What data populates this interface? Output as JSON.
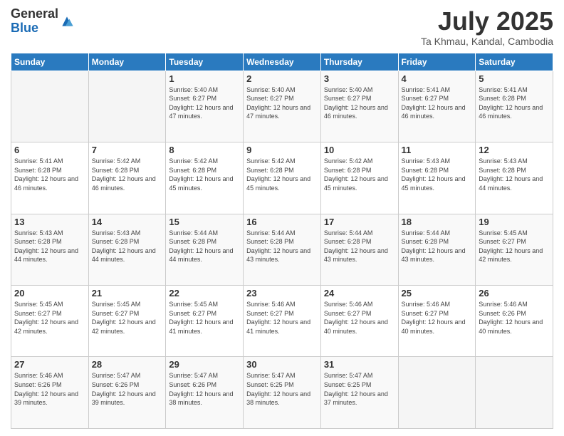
{
  "logo": {
    "general": "General",
    "blue": "Blue"
  },
  "header": {
    "month": "July 2025",
    "location": "Ta Khmau, Kandal, Cambodia"
  },
  "weekdays": [
    "Sunday",
    "Monday",
    "Tuesday",
    "Wednesday",
    "Thursday",
    "Friday",
    "Saturday"
  ],
  "weeks": [
    [
      {
        "day": "",
        "info": ""
      },
      {
        "day": "",
        "info": ""
      },
      {
        "day": "1",
        "info": "Sunrise: 5:40 AM\nSunset: 6:27 PM\nDaylight: 12 hours and 47 minutes."
      },
      {
        "day": "2",
        "info": "Sunrise: 5:40 AM\nSunset: 6:27 PM\nDaylight: 12 hours and 47 minutes."
      },
      {
        "day": "3",
        "info": "Sunrise: 5:40 AM\nSunset: 6:27 PM\nDaylight: 12 hours and 46 minutes."
      },
      {
        "day": "4",
        "info": "Sunrise: 5:41 AM\nSunset: 6:27 PM\nDaylight: 12 hours and 46 minutes."
      },
      {
        "day": "5",
        "info": "Sunrise: 5:41 AM\nSunset: 6:28 PM\nDaylight: 12 hours and 46 minutes."
      }
    ],
    [
      {
        "day": "6",
        "info": "Sunrise: 5:41 AM\nSunset: 6:28 PM\nDaylight: 12 hours and 46 minutes."
      },
      {
        "day": "7",
        "info": "Sunrise: 5:42 AM\nSunset: 6:28 PM\nDaylight: 12 hours and 46 minutes."
      },
      {
        "day": "8",
        "info": "Sunrise: 5:42 AM\nSunset: 6:28 PM\nDaylight: 12 hours and 45 minutes."
      },
      {
        "day": "9",
        "info": "Sunrise: 5:42 AM\nSunset: 6:28 PM\nDaylight: 12 hours and 45 minutes."
      },
      {
        "day": "10",
        "info": "Sunrise: 5:42 AM\nSunset: 6:28 PM\nDaylight: 12 hours and 45 minutes."
      },
      {
        "day": "11",
        "info": "Sunrise: 5:43 AM\nSunset: 6:28 PM\nDaylight: 12 hours and 45 minutes."
      },
      {
        "day": "12",
        "info": "Sunrise: 5:43 AM\nSunset: 6:28 PM\nDaylight: 12 hours and 44 minutes."
      }
    ],
    [
      {
        "day": "13",
        "info": "Sunrise: 5:43 AM\nSunset: 6:28 PM\nDaylight: 12 hours and 44 minutes."
      },
      {
        "day": "14",
        "info": "Sunrise: 5:43 AM\nSunset: 6:28 PM\nDaylight: 12 hours and 44 minutes."
      },
      {
        "day": "15",
        "info": "Sunrise: 5:44 AM\nSunset: 6:28 PM\nDaylight: 12 hours and 44 minutes."
      },
      {
        "day": "16",
        "info": "Sunrise: 5:44 AM\nSunset: 6:28 PM\nDaylight: 12 hours and 43 minutes."
      },
      {
        "day": "17",
        "info": "Sunrise: 5:44 AM\nSunset: 6:28 PM\nDaylight: 12 hours and 43 minutes."
      },
      {
        "day": "18",
        "info": "Sunrise: 5:44 AM\nSunset: 6:28 PM\nDaylight: 12 hours and 43 minutes."
      },
      {
        "day": "19",
        "info": "Sunrise: 5:45 AM\nSunset: 6:27 PM\nDaylight: 12 hours and 42 minutes."
      }
    ],
    [
      {
        "day": "20",
        "info": "Sunrise: 5:45 AM\nSunset: 6:27 PM\nDaylight: 12 hours and 42 minutes."
      },
      {
        "day": "21",
        "info": "Sunrise: 5:45 AM\nSunset: 6:27 PM\nDaylight: 12 hours and 42 minutes."
      },
      {
        "day": "22",
        "info": "Sunrise: 5:45 AM\nSunset: 6:27 PM\nDaylight: 12 hours and 41 minutes."
      },
      {
        "day": "23",
        "info": "Sunrise: 5:46 AM\nSunset: 6:27 PM\nDaylight: 12 hours and 41 minutes."
      },
      {
        "day": "24",
        "info": "Sunrise: 5:46 AM\nSunset: 6:27 PM\nDaylight: 12 hours and 40 minutes."
      },
      {
        "day": "25",
        "info": "Sunrise: 5:46 AM\nSunset: 6:27 PM\nDaylight: 12 hours and 40 minutes."
      },
      {
        "day": "26",
        "info": "Sunrise: 5:46 AM\nSunset: 6:26 PM\nDaylight: 12 hours and 40 minutes."
      }
    ],
    [
      {
        "day": "27",
        "info": "Sunrise: 5:46 AM\nSunset: 6:26 PM\nDaylight: 12 hours and 39 minutes."
      },
      {
        "day": "28",
        "info": "Sunrise: 5:47 AM\nSunset: 6:26 PM\nDaylight: 12 hours and 39 minutes."
      },
      {
        "day": "29",
        "info": "Sunrise: 5:47 AM\nSunset: 6:26 PM\nDaylight: 12 hours and 38 minutes."
      },
      {
        "day": "30",
        "info": "Sunrise: 5:47 AM\nSunset: 6:25 PM\nDaylight: 12 hours and 38 minutes."
      },
      {
        "day": "31",
        "info": "Sunrise: 5:47 AM\nSunset: 6:25 PM\nDaylight: 12 hours and 37 minutes."
      },
      {
        "day": "",
        "info": ""
      },
      {
        "day": "",
        "info": ""
      }
    ]
  ]
}
